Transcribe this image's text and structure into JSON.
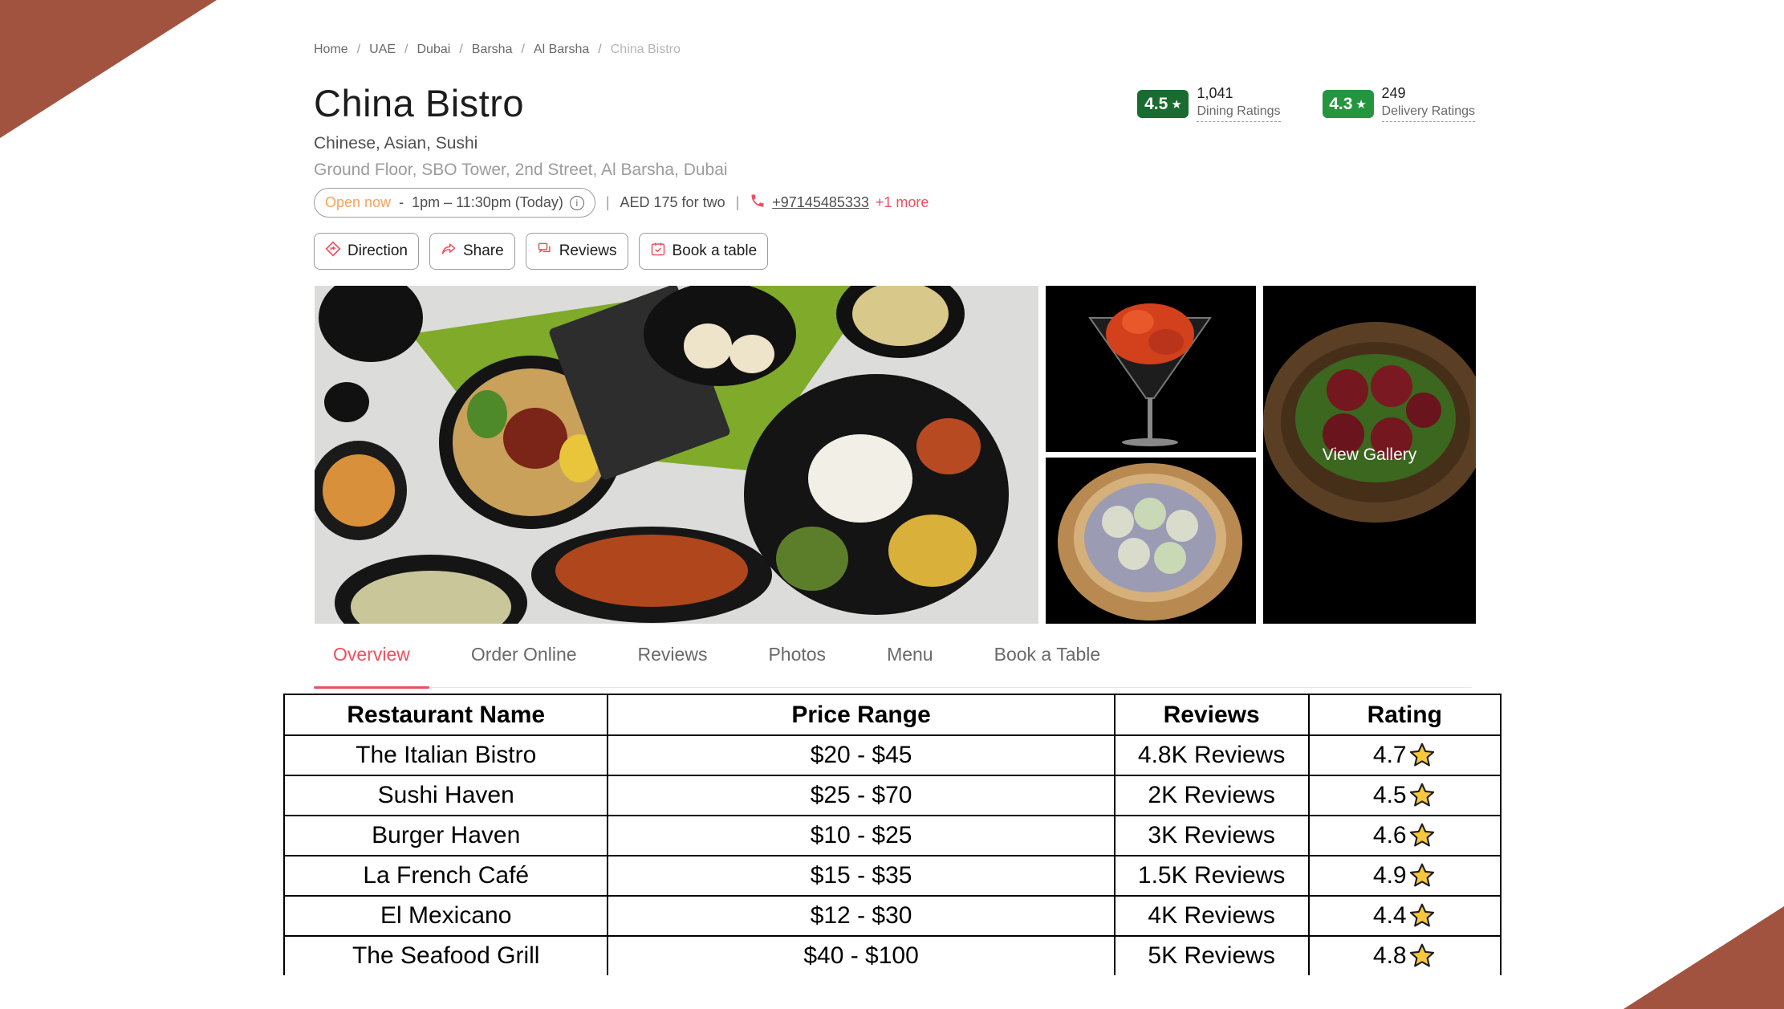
{
  "breadcrumb": {
    "items": [
      "Home",
      "UAE",
      "Dubai",
      "Barsha",
      "Al Barsha",
      "China Bistro"
    ],
    "separator": "/"
  },
  "restaurant": {
    "name": "China Bistro",
    "cuisines": "Chinese, Asian, Sushi",
    "address": "Ground Floor, SBO Tower, 2nd Street, Al Barsha, Dubai",
    "status": "Open now",
    "dash": "-",
    "hours": "1pm – 11:30pm (Today)",
    "cost": "AED 175 for two",
    "phone": "+97145485333",
    "more": "+1 more",
    "info_icon": "i",
    "pipe": "|"
  },
  "ratings": {
    "dining": {
      "score": "4.5",
      "count": "1,041",
      "label": "Dining Ratings"
    },
    "delivery": {
      "score": "4.3",
      "count": "249",
      "label": "Delivery Ratings"
    },
    "star": "★"
  },
  "actions": {
    "direction": "Direction",
    "share": "Share",
    "reviews": "Reviews",
    "book": "Book a table"
  },
  "gallery": {
    "view_label": "View Gallery"
  },
  "tabs": [
    "Overview",
    "Order Online",
    "Reviews",
    "Photos",
    "Menu",
    "Book a Table"
  ],
  "table": {
    "headers": [
      "Restaurant Name",
      "Price Range",
      "Reviews",
      "Rating"
    ],
    "rows": [
      [
        "The Italian Bistro",
        "$20 - $45",
        "4.8K Reviews",
        "4.7"
      ],
      [
        "Sushi Haven",
        "$25 - $70",
        "2K Reviews",
        "4.5"
      ],
      [
        "Burger Haven",
        "$10 - $25",
        "3K Reviews",
        "4.6"
      ],
      [
        "La French Café",
        "$15 - $35",
        "1.5K Reviews",
        "4.9"
      ],
      [
        "El Mexicano",
        "$12 - $30",
        "4K Reviews",
        "4.4"
      ],
      [
        "The Seafood Grill",
        "$40 - $100",
        "5K Reviews",
        "4.8"
      ]
    ]
  },
  "colors": {
    "accent": "#ef4f5f",
    "rating_green": "#24963f",
    "corner": "#a2533f",
    "open": "#f3a45a"
  }
}
